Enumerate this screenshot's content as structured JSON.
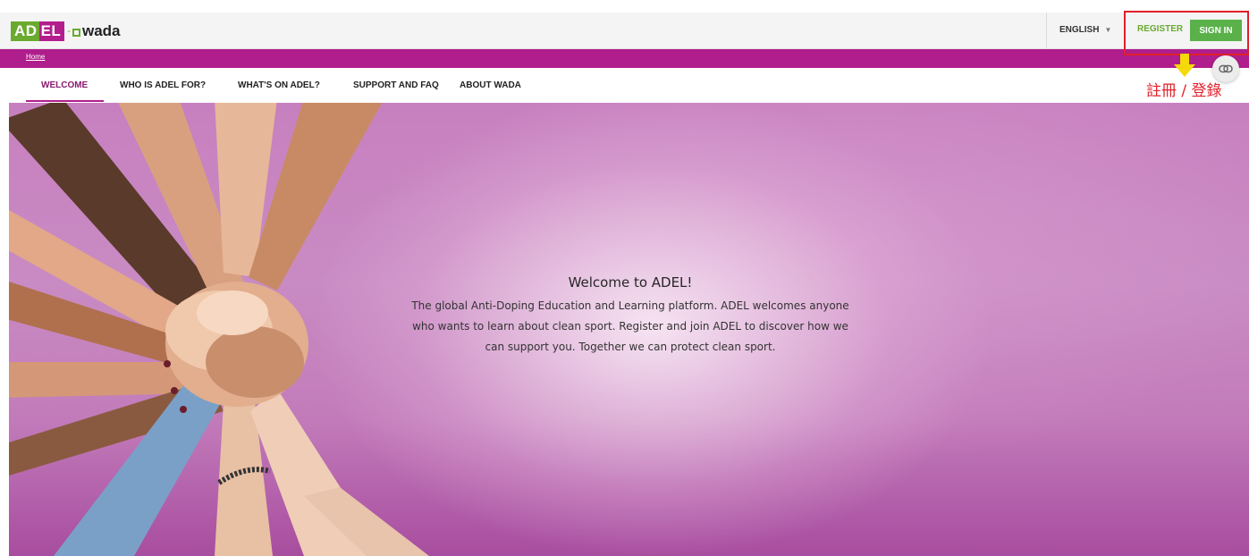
{
  "header": {
    "logo_ad": "AD",
    "logo_el": "EL",
    "logo_wada": "wada",
    "language": "ENGLISH",
    "register": "REGISTER",
    "sign_in": "SIGN IN"
  },
  "breadcrumb": {
    "home": "Home"
  },
  "nav": {
    "items": [
      {
        "label": "WELCOME",
        "active": true
      },
      {
        "label": "WHO IS ADEL FOR?"
      },
      {
        "label": "WHAT'S ON ADEL?"
      },
      {
        "label": "SUPPORT AND FAQ"
      },
      {
        "label": "ABOUT WADA"
      }
    ]
  },
  "annotation": {
    "label": "註冊 / 登錄",
    "color": "#e2222c",
    "arrow_color": "#f5d90a"
  },
  "hero": {
    "title": "Welcome to ADEL!",
    "body": "The global Anti-Doping Education and Learning platform. ADEL welcomes anyone who wants to learn about clean sport. Register and join ADEL to discover how we can support you. Together we can protect clean sport."
  },
  "colors": {
    "brand_magenta": "#b01d8c",
    "brand_green": "#6aaa2f",
    "button_green": "#5ab14a"
  },
  "icons": {
    "language_caret": "chevron-down-icon",
    "link_button": "link-icon",
    "annotation_arrow": "arrow-down-icon"
  }
}
